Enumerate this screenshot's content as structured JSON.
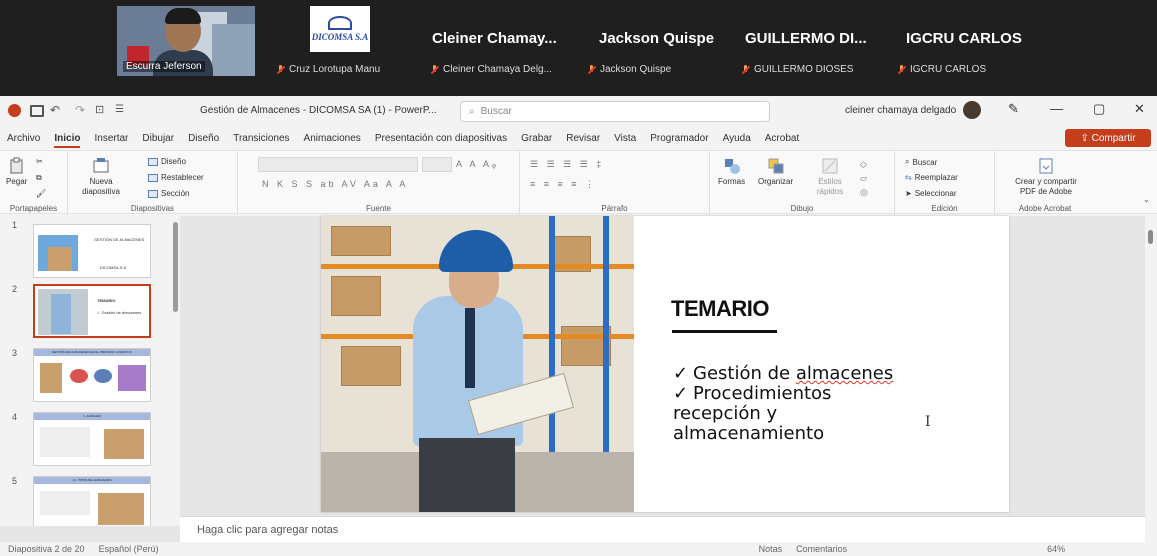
{
  "call": {
    "tile_labels": [
      "Escurra Jeferson",
      "Cruz Lorotupa Manu"
    ],
    "logo_text": "DICOMSA S.A",
    "participants": [
      {
        "display": "Cleiner Chamay...",
        "sub": "Cleiner Chamaya Delg..."
      },
      {
        "display": "Jackson Quispe",
        "sub": "Jackson Quispe"
      },
      {
        "display": "GUILLERMO DI...",
        "sub": "GUILLERMO DIOSES"
      },
      {
        "display": "IGCRU CARLOS",
        "sub": "IGCRU CARLOS"
      }
    ]
  },
  "window": {
    "title": "Gestión de Almacenes - DICOMSA SA (1) - PowerP...",
    "search_placeholder": "Buscar",
    "user_name": "cleiner chamaya delgado",
    "controls": [
      "—",
      "▢",
      "✕"
    ]
  },
  "tabs": [
    "Archivo",
    "Inicio",
    "Insertar",
    "Dibujar",
    "Diseño",
    "Transiciones",
    "Animaciones",
    "Presentación con diapositivas",
    "Grabar",
    "Revisar",
    "Vista",
    "Programador",
    "Ayuda",
    "Acrobat"
  ],
  "share_label": "Compartir",
  "ribbon": {
    "pegar": "Pegar",
    "nueva": "Nueva diapositiva",
    "diseno": "Diseño",
    "restablecer": "Restablecer",
    "seccion": "Sección",
    "formas": "Formas",
    "organizar": "Organizar",
    "estilos": "Estilos rápidos",
    "buscar": "Buscar",
    "reemplazar": "Reemplazar",
    "seleccionar": "Seleccionar",
    "crear": "Crear y compartir PDF de Adobe",
    "groups": [
      "Portapapeles",
      "Diapositivas",
      "Fuente",
      "Párrafo",
      "Dibujo",
      "Edición",
      "Adobe Acrobat"
    ]
  },
  "thumbnails": [
    {
      "num": "1",
      "title": "GESTIÓN DE ALMACENES",
      "sub": "DICOMSA S.A"
    },
    {
      "num": "2",
      "title": "TEMARIO",
      "sub": "✓ Gestión de almacenes"
    },
    {
      "num": "3",
      "title": "GESTIÓN DE ALMACENES EN EL PROCESO LOGÍSTICO",
      "sub": ""
    },
    {
      "num": "4",
      "title": "1. ALMACÉN",
      "sub": ""
    },
    {
      "num": "5",
      "title": "1.1. TIPOS DE ALMACENES",
      "sub": ""
    }
  ],
  "slide": {
    "title": "TEMARIO",
    "bullet1": "Gestión de almacenes",
    "bullet2_lines": [
      "Procedimientos",
      "recepción y",
      "almacenamiento"
    ],
    "check": "✓"
  },
  "notes_placeholder": "Haga clic para agregar notas",
  "status": {
    "slide_count": "Diapositiva 2 de 20",
    "language": "Español (Perú)",
    "notas": "Notas",
    "comentarios": "Comentarios",
    "zoom": "64%"
  }
}
